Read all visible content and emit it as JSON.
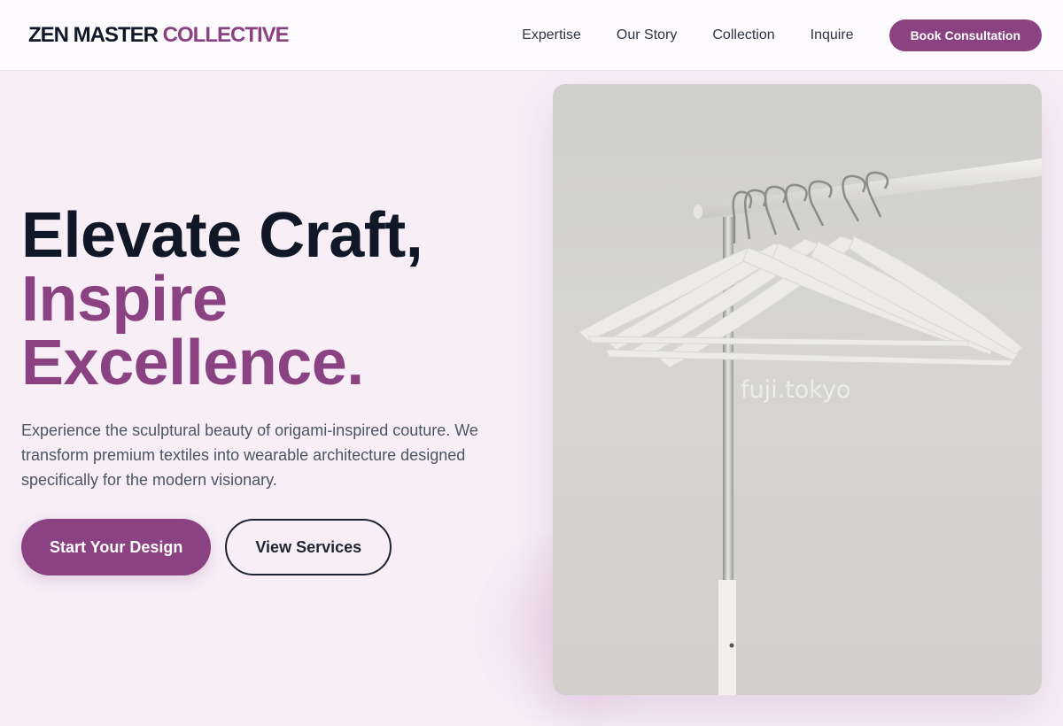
{
  "header": {
    "logo_primary": "ZEN MASTER",
    "logo_accent": "COLLECTIVE",
    "nav": [
      "Expertise",
      "Our Story",
      "Collection",
      "Inquire"
    ],
    "cta_label": "Book Consultation"
  },
  "hero": {
    "headline_line1": "Elevate Craft,",
    "headline_line2": "Inspire",
    "headline_line3": "Excellence.",
    "subtext": "Experience the sculptural beauty of origami-inspired couture. We transform premium textiles into wearable architecture designed specifically for the modern visionary.",
    "primary_cta": "Start Your Design",
    "secondary_cta": "View Services",
    "image_watermark": "fuji.tokyo"
  },
  "colors": {
    "accent": "#8b4282",
    "text_dark": "#101828",
    "background": "#f7eef6"
  }
}
